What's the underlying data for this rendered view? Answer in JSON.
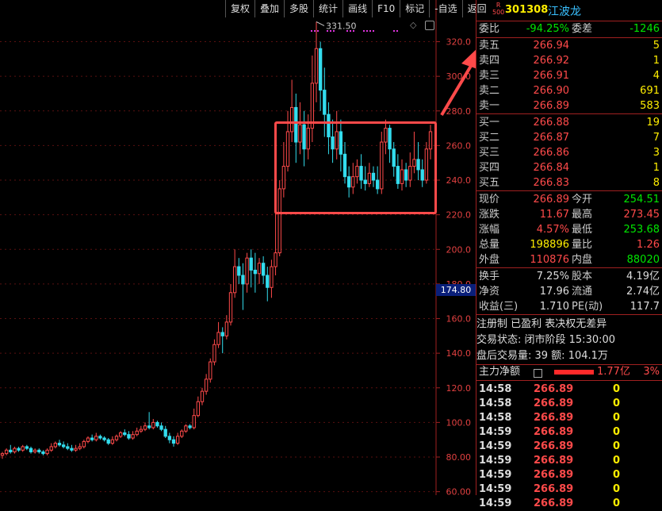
{
  "toolbar": {
    "items": [
      "复权",
      "叠加",
      "多股",
      "统计",
      "画线",
      "F10",
      "标记",
      "-自选",
      "返回"
    ]
  },
  "chart_data": {
    "type": "candlestick",
    "y_ticks": [
      320,
      300,
      280,
      260,
      240,
      220,
      200,
      180,
      160,
      140,
      120,
      100,
      80,
      60
    ],
    "y_tick_labels": [
      "320.0",
      "300.0",
      "280.0",
      "260.0",
      "240.0",
      "220.0",
      "200.0",
      "180.0",
      "160.0",
      "140.0",
      "120.0",
      "100.0",
      "80.00",
      "60.00"
    ],
    "ylim": [
      58,
      334
    ],
    "high_marker": "331.50",
    "current_price_label": "174.80",
    "candles": [
      [
        81,
        82,
        79,
        83
      ],
      [
        82,
        84,
        81,
        85
      ],
      [
        84,
        83,
        82,
        87
      ],
      [
        83,
        85,
        82,
        86
      ],
      [
        85,
        84,
        83,
        86
      ],
      [
        84,
        86,
        83,
        87
      ],
      [
        86,
        85,
        84,
        87
      ],
      [
        85,
        83,
        82,
        86
      ],
      [
        83,
        84,
        82,
        85
      ],
      [
        84,
        83,
        82,
        85
      ],
      [
        83,
        82,
        81,
        84
      ],
      [
        82,
        84,
        81,
        85
      ],
      [
        84,
        86,
        83,
        88
      ],
      [
        86,
        88,
        85,
        89
      ],
      [
        88,
        87,
        86,
        90
      ],
      [
        87,
        86,
        85,
        89
      ],
      [
        86,
        85,
        84,
        88
      ],
      [
        85,
        84,
        83,
        87
      ],
      [
        84,
        85,
        83,
        87
      ],
      [
        85,
        86,
        84,
        88
      ],
      [
        86,
        89,
        85,
        90
      ],
      [
        89,
        91,
        88,
        92
      ],
      [
        91,
        90,
        89,
        93
      ],
      [
        90,
        92,
        89,
        94
      ],
      [
        92,
        91,
        90,
        93
      ],
      [
        91,
        90,
        89,
        92
      ],
      [
        90,
        88,
        87,
        91
      ],
      [
        88,
        90,
        87,
        92
      ],
      [
        90,
        92,
        89,
        93
      ],
      [
        92,
        94,
        91,
        95
      ],
      [
        94,
        93,
        92,
        96
      ],
      [
        93,
        91,
        90,
        95
      ],
      [
        91,
        93,
        90,
        95
      ],
      [
        93,
        95,
        92,
        97
      ],
      [
        95,
        96,
        94,
        98
      ],
      [
        96,
        98,
        95,
        100
      ],
      [
        98,
        97,
        96,
        106
      ],
      [
        97,
        100,
        96,
        102
      ],
      [
        100,
        98,
        97,
        101
      ],
      [
        98,
        96,
        95,
        100
      ],
      [
        96,
        92,
        91,
        98
      ],
      [
        92,
        90,
        88,
        94
      ],
      [
        90,
        88,
        86,
        92
      ],
      [
        88,
        92,
        87,
        94
      ],
      [
        92,
        95,
        91,
        96
      ],
      [
        95,
        98,
        94,
        99
      ],
      [
        98,
        97,
        96,
        99
      ],
      [
        97,
        104,
        96,
        108
      ],
      [
        104,
        112,
        103,
        115
      ],
      [
        112,
        118,
        110,
        120
      ],
      [
        118,
        125,
        116,
        128
      ],
      [
        125,
        135,
        123,
        137
      ],
      [
        135,
        145,
        133,
        148
      ],
      [
        145,
        152,
        143,
        158
      ],
      [
        152,
        150,
        140,
        155
      ],
      [
        150,
        158,
        148,
        162
      ],
      [
        158,
        175,
        156,
        180
      ],
      [
        175,
        190,
        172,
        200
      ],
      [
        190,
        185,
        180,
        195
      ],
      [
        185,
        180,
        165,
        192
      ],
      [
        180,
        195,
        175,
        198
      ],
      [
        195,
        188,
        178,
        200
      ],
      [
        188,
        186,
        175,
        198
      ],
      [
        186,
        192,
        180,
        195
      ],
      [
        192,
        185,
        180,
        196
      ],
      [
        185,
        178,
        170,
        190
      ],
      [
        178,
        190,
        172,
        194
      ],
      [
        190,
        198,
        185,
        230
      ],
      [
        198,
        235,
        196,
        240
      ],
      [
        235,
        248,
        230,
        262
      ],
      [
        248,
        268,
        245,
        280
      ],
      [
        268,
        282,
        262,
        298
      ],
      [
        282,
        262,
        250,
        290
      ],
      [
        262,
        272,
        255,
        285
      ],
      [
        272,
        258,
        248,
        280
      ],
      [
        258,
        270,
        252,
        278
      ],
      [
        270,
        296,
        262,
        312
      ],
      [
        296,
        316,
        285,
        331.5
      ],
      [
        316,
        292,
        280,
        320
      ],
      [
        292,
        278,
        265,
        305
      ],
      [
        278,
        265,
        255,
        285
      ],
      [
        265,
        258,
        250,
        275
      ],
      [
        258,
        268,
        252,
        280
      ],
      [
        268,
        255,
        245,
        275
      ],
      [
        255,
        242,
        238,
        262
      ],
      [
        242,
        236,
        230,
        248
      ],
      [
        236,
        242,
        232,
        250
      ],
      [
        242,
        248,
        238,
        252
      ],
      [
        248,
        240,
        235,
        255
      ],
      [
        240,
        238,
        234,
        248
      ],
      [
        238,
        244,
        236,
        250
      ],
      [
        244,
        240,
        236,
        248
      ],
      [
        240,
        235,
        232,
        248
      ],
      [
        235,
        262,
        232,
        268
      ],
      [
        262,
        270,
        255,
        275
      ],
      [
        270,
        258,
        250,
        272
      ],
      [
        258,
        248,
        242,
        262
      ],
      [
        248,
        238,
        235,
        255
      ],
      [
        238,
        246,
        234,
        252
      ],
      [
        246,
        240,
        236,
        250
      ],
      [
        240,
        248,
        236,
        256
      ],
      [
        248,
        252,
        244,
        268
      ],
      [
        252,
        246,
        240,
        262
      ],
      [
        246,
        240,
        236,
        252
      ],
      [
        240,
        258,
        238,
        262
      ],
      [
        258,
        268,
        252,
        272
      ]
    ]
  },
  "stock": {
    "badge_top": "R",
    "badge_bottom": "500",
    "code": "301308",
    "name": "江波龙"
  },
  "weibi": {
    "label": "委比",
    "value": "-94.25%",
    "label2": "委差",
    "value2": "-1246"
  },
  "asks": [
    {
      "label": "卖五",
      "price": "266.94",
      "vol": "5"
    },
    {
      "label": "卖四",
      "price": "266.92",
      "vol": "1"
    },
    {
      "label": "卖三",
      "price": "266.91",
      "vol": "4"
    },
    {
      "label": "卖二",
      "price": "266.90",
      "vol": "691"
    },
    {
      "label": "卖一",
      "price": "266.89",
      "vol": "583"
    }
  ],
  "bids": [
    {
      "label": "买一",
      "price": "266.88",
      "vol": "19"
    },
    {
      "label": "买二",
      "price": "266.87",
      "vol": "7"
    },
    {
      "label": "买三",
      "price": "266.86",
      "vol": "3"
    },
    {
      "label": "买四",
      "price": "266.84",
      "vol": "1"
    },
    {
      "label": "买五",
      "price": "266.83",
      "vol": "8"
    }
  ],
  "quote": [
    {
      "l1": "现价",
      "v1": "266.89",
      "l2": "今开",
      "v2": "254.51"
    },
    {
      "l1": "涨跌",
      "v1": "11.67",
      "l2": "最高",
      "v2": "273.45"
    },
    {
      "l1": "涨幅",
      "v1": "4.57%",
      "l2": "最低",
      "v2": "253.68"
    },
    {
      "l1": "总量",
      "v1": "198896",
      "l2": "量比",
      "v2": "1.26"
    },
    {
      "l1": "外盘",
      "v1": "110876",
      "l2": "内盘",
      "v2": "88020"
    }
  ],
  "fin": [
    {
      "l1": "换手",
      "v1": "7.25%",
      "l2": "股本",
      "v2": "4.19亿"
    },
    {
      "l1": "净资",
      "v1": "17.96",
      "l2": "流通",
      "v2": "2.74亿"
    },
    {
      "l1": "收益(三)",
      "v1": "1.710",
      "l2": "PE(动)",
      "v2": "117.7"
    }
  ],
  "info": {
    "tags": "注册制 已盈利 表决权无差异",
    "status": "交易状态: 闭市阶段 15:30:00",
    "after": "盘后交易量: 39  额: 104.1万"
  },
  "main_flow": {
    "label": "主力净额",
    "value": "1.77亿",
    "pct": "3%"
  },
  "ticks": [
    {
      "time": "14:58",
      "price": "266.89",
      "vol": "0"
    },
    {
      "time": "14:58",
      "price": "266.89",
      "vol": "0"
    },
    {
      "time": "14:58",
      "price": "266.89",
      "vol": "0"
    },
    {
      "time": "14:59",
      "price": "266.89",
      "vol": "0"
    },
    {
      "time": "14:59",
      "price": "266.89",
      "vol": "0"
    },
    {
      "time": "14:59",
      "price": "266.89",
      "vol": "0"
    },
    {
      "time": "14:59",
      "price": "266.89",
      "vol": "0"
    },
    {
      "time": "14:59",
      "price": "266.89",
      "vol": "0"
    },
    {
      "time": "14:59",
      "price": "266.89",
      "vol": "0"
    }
  ],
  "colors": {
    "up": "#ff4a4a",
    "down": "#33ddee",
    "axis": "#a02020",
    "grid": "#5a1010",
    "highlight": "#ff4a4a",
    "arrow": "#ff4a4a"
  }
}
